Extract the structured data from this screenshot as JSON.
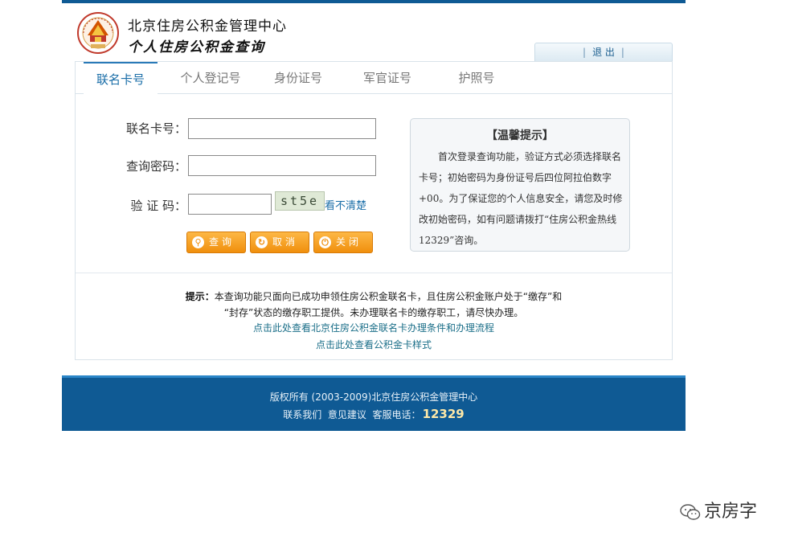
{
  "header": {
    "org_name": "北京住房公积金管理中心",
    "system_name": "个人住房公积金查询",
    "logout_label": "退 出",
    "logout_sep": "|"
  },
  "tabs": [
    {
      "label": "联名卡号",
      "active": true
    },
    {
      "label": "个人登记号",
      "active": false
    },
    {
      "label": "身份证号",
      "active": false
    },
    {
      "label": "军官证号",
      "active": false
    },
    {
      "label": "护照号",
      "active": false
    }
  ],
  "form": {
    "card_label": "联名卡号：",
    "card_value": "",
    "password_label": "查询密码：",
    "password_value": "",
    "captcha_label": "验 证 码：",
    "captcha_value": "",
    "captcha_text": "st5e",
    "captcha_refresh": "看不清楚"
  },
  "buttons": {
    "query": "查询",
    "cancel": "取消",
    "close": "关闭"
  },
  "tip": {
    "title": "【温馨提示】",
    "body": "首次登录查询功能，验证方式必须选择联名卡号；初始密码为身份证号后四位阿拉伯数字+00。为了保证您的个人信息安全，请您及时修改初始密码，如有问题请拨打“住房公积金热线12329”咨询。"
  },
  "notice": {
    "prefix": "提示：",
    "line1": "本查询功能只面向已成功申领住房公积金联名卡，且住房公积金账户处于“缴存”和",
    "line2": "“封存”状态的缴存职工提供。未办理联名卡的缴存职工，请尽快办理。",
    "link1": "点击此处查看北京住房公积金联名卡办理条件和办理流程",
    "link2": "点击此处查看公积金卡样式"
  },
  "footer": {
    "copyright": "版权所有 (2003-2009)北京住房公积金管理中心",
    "contact": "联系我们",
    "feedback": "意见建议",
    "hotline_label": "客服电话：",
    "hotline": "12329"
  },
  "watermark": {
    "text": "京房字"
  },
  "colors": {
    "brand_blue": "#0f5a94",
    "button_orange": "#f08f0d",
    "link": "#1a6ea8"
  }
}
